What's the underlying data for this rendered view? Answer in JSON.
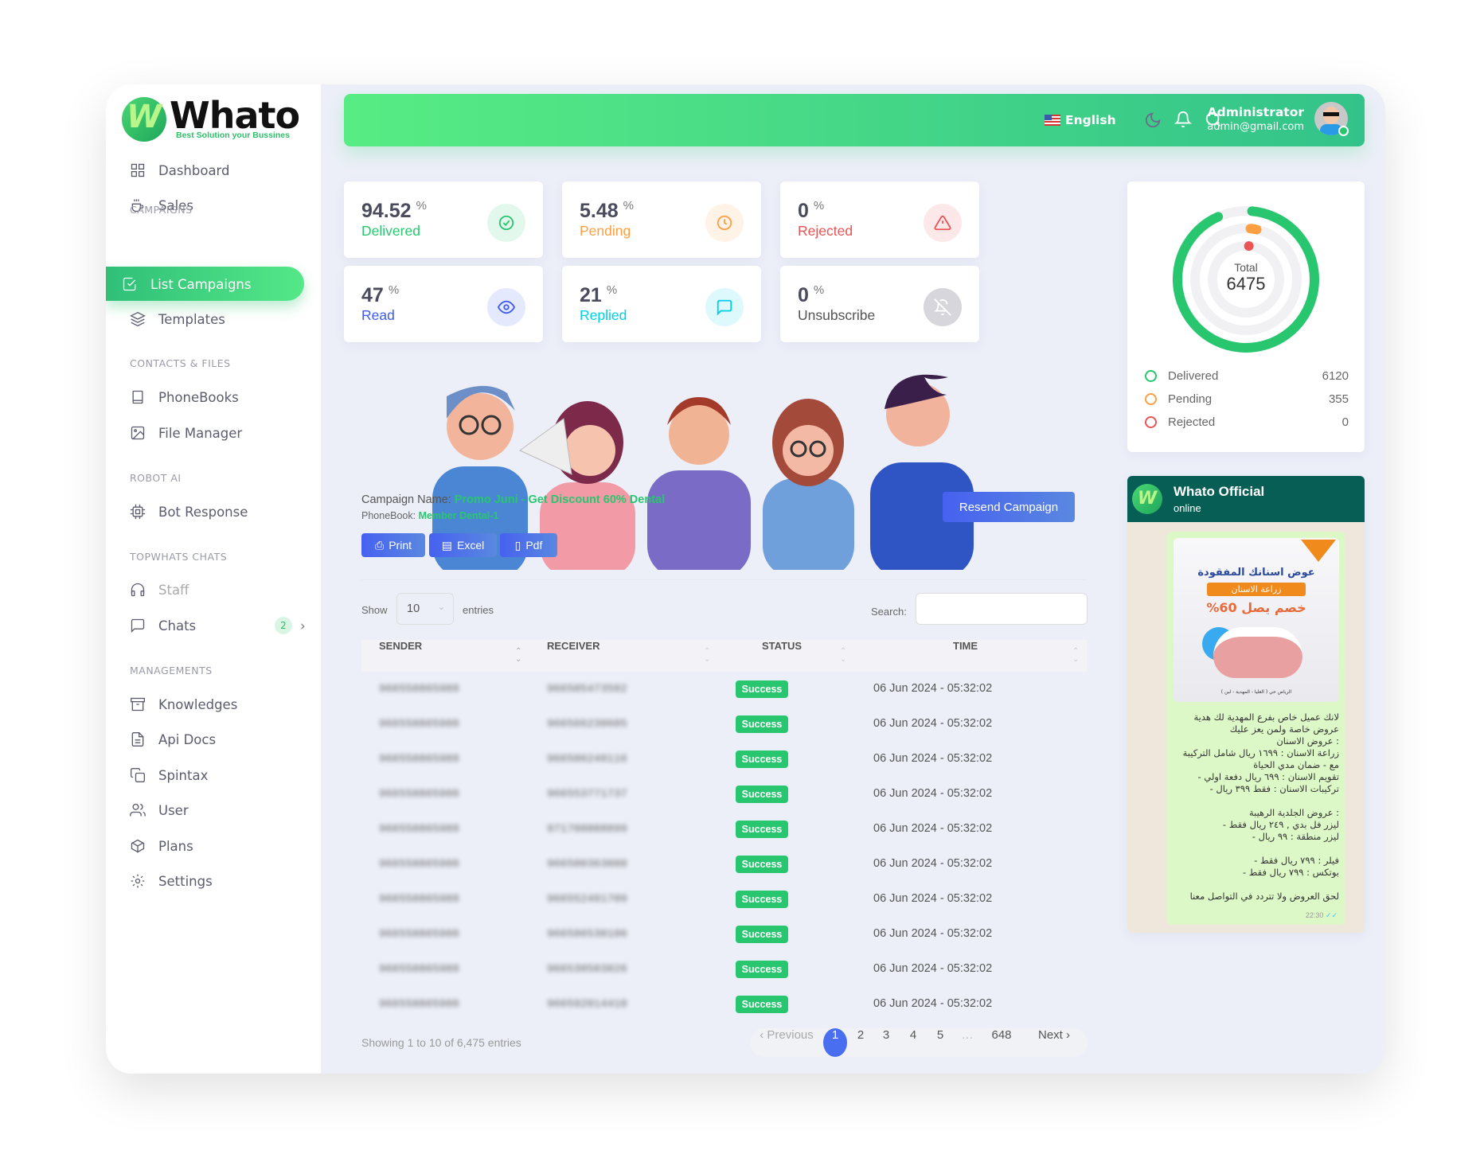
{
  "brand": {
    "name": "Whato",
    "tagline": "Best Solution your Bussines"
  },
  "sidebar": {
    "items": [
      {
        "label": "Dashboard",
        "icon": "grid-icon"
      },
      {
        "label": "Sales",
        "icon": "coffee-cup-icon"
      }
    ],
    "sections": [
      {
        "title": "CAMPAIGNS",
        "items": [
          {
            "label": "List Campaigns",
            "icon": "checkbox-icon",
            "active": true
          },
          {
            "label": "Templates",
            "icon": "layers-icon"
          }
        ]
      },
      {
        "title": "CONTACTS & FILES",
        "items": [
          {
            "label": "PhoneBooks",
            "icon": "book-icon"
          },
          {
            "label": "File Manager",
            "icon": "image-icon"
          }
        ]
      },
      {
        "title": "ROBOT AI",
        "items": [
          {
            "label": "Bot Response",
            "icon": "cpu-icon"
          }
        ]
      },
      {
        "title": "TOPWHATS CHATS",
        "items": [
          {
            "label": "Staff",
            "icon": "headphones-icon"
          },
          {
            "label": "Chats",
            "icon": "message-square-icon",
            "badge": "2"
          }
        ]
      },
      {
        "title": "MANAGEMENTS",
        "items": [
          {
            "label": "Knowledges",
            "icon": "archive-icon"
          },
          {
            "label": "Api Docs",
            "icon": "file-text-icon"
          },
          {
            "label": "Spintax",
            "icon": "copy-icon"
          },
          {
            "label": "User",
            "icon": "users-icon"
          },
          {
            "label": "Plans",
            "icon": "package-icon"
          },
          {
            "label": "Settings",
            "icon": "settings-icon"
          }
        ]
      }
    ]
  },
  "header": {
    "language": "English",
    "user_name": "Administrator",
    "user_email": "admin@gmail.com"
  },
  "stats": [
    {
      "value": "94.52",
      "unit": "%",
      "label": "Delivered",
      "color": "#28c76f",
      "icon": "check-circle-icon"
    },
    {
      "value": "5.48",
      "unit": "%",
      "label": "Pending",
      "color": "#ff9f43",
      "icon": "clock-icon"
    },
    {
      "value": "0",
      "unit": "%",
      "label": "Rejected",
      "color": "#ea5455",
      "icon": "alert-triangle-icon"
    },
    {
      "value": "47",
      "unit": "%",
      "label": "Read",
      "color": "#3d5af1",
      "icon": "eye-icon"
    },
    {
      "value": "21",
      "unit": "%",
      "label": "Replied",
      "color": "#00cfe8",
      "icon": "message-icon"
    },
    {
      "value": "0",
      "unit": "%",
      "label": "Unsubscribe",
      "color": "#4b4b5e",
      "icon": "bell-off-icon"
    }
  ],
  "chart_data": {
    "type": "pie",
    "title": "",
    "center_label": "Total",
    "center_value": "6475",
    "series": [
      {
        "name": "Delivered",
        "value": 6120,
        "color": "#28c76f"
      },
      {
        "name": "Pending",
        "value": 355,
        "color": "#ff9f43"
      },
      {
        "name": "Rejected",
        "value": 0,
        "color": "#ea5455"
      }
    ]
  },
  "campaign": {
    "name_label": "Campaign Name:",
    "name": "Promo Juni - Get Discount 60% Dental",
    "phonebook_label": "PhoneBook:",
    "phonebook": "Member Dental-1",
    "resend_label": "Resend Campaign",
    "export": [
      "Print",
      "Excel",
      "Pdf"
    ],
    "show_label": "Show",
    "page_size": "10",
    "entries_label": "entries",
    "search_label": "Search:",
    "search_value": ""
  },
  "table": {
    "columns": [
      "SENDER",
      "RECEIVER",
      "STATUS",
      "TIME"
    ],
    "rows": [
      {
        "sender": "966558865988",
        "receiver": "966505473582",
        "status": "Success",
        "time": "06 Jun 2024 - 05:32:02"
      },
      {
        "sender": "966558865988",
        "receiver": "966566230605",
        "status": "Success",
        "time": "06 Jun 2024 - 05:32:02"
      },
      {
        "sender": "966558865988",
        "receiver": "966506248116",
        "status": "Success",
        "time": "06 Jun 2024 - 05:32:02"
      },
      {
        "sender": "966558865988",
        "receiver": "966553771737",
        "status": "Success",
        "time": "06 Jun 2024 - 05:32:02"
      },
      {
        "sender": "966558865988",
        "receiver": "971708008899",
        "status": "Success",
        "time": "06 Jun 2024 - 05:32:02"
      },
      {
        "sender": "966558865988",
        "receiver": "966500363088",
        "status": "Success",
        "time": "06 Jun 2024 - 05:32:02"
      },
      {
        "sender": "966558865988",
        "receiver": "966552491709",
        "status": "Success",
        "time": "06 Jun 2024 - 05:32:02"
      },
      {
        "sender": "966558865988",
        "receiver": "966586530106",
        "status": "Success",
        "time": "06 Jun 2024 - 05:32:02"
      },
      {
        "sender": "966558865988",
        "receiver": "966538503826",
        "status": "Success",
        "time": "06 Jun 2024 - 05:32:02"
      },
      {
        "sender": "966558865988",
        "receiver": "966592014410",
        "status": "Success",
        "time": "06 Jun 2024 - 05:32:02"
      }
    ],
    "info": "Showing 1 to 10 of 6,475 entries",
    "pagination": {
      "previous": "‹ Previous",
      "pages": [
        "1",
        "2",
        "3",
        "4",
        "5",
        "…",
        "648"
      ],
      "current": "1",
      "next": "Next ›"
    }
  },
  "chat": {
    "name": "Whato Official",
    "status": "online",
    "image_text": {
      "headline": "عوض اسنانك المفقودة",
      "banner": "زراعة الاسنان",
      "discount": "خصم يصل 60%",
      "location": "الرياض حي ( العليا - المهدية - لبن )"
    },
    "message": "لانك عميل خاص بفرع المهدية لك هدية عروض خاصة ولمن يعز عليك\n: عروض الاسنان\nزراعة الاسنان : ١٦٩٩ ريال شامل التركيبة مع - ضمان مدي الحياة\nتقويم الاسنان : ٦٩٩ ريال دفعة اولي -\nتركيبات الاسنان : فقط ٣٩٩ ريال -\n\n: عروض الجلدية الرهيبة\nليزر فل بدي , ٢٤٩ ريال فقط -\nليزر منطقة : ٩٩ ريال -\n\nفيلر : ٧٩٩ ريال فقط -\nبوتكس : ٧٩٩ ريال فقط -\n\nلحق العروض ولا تتردد في التواصل معنا",
    "time": "22:30"
  }
}
